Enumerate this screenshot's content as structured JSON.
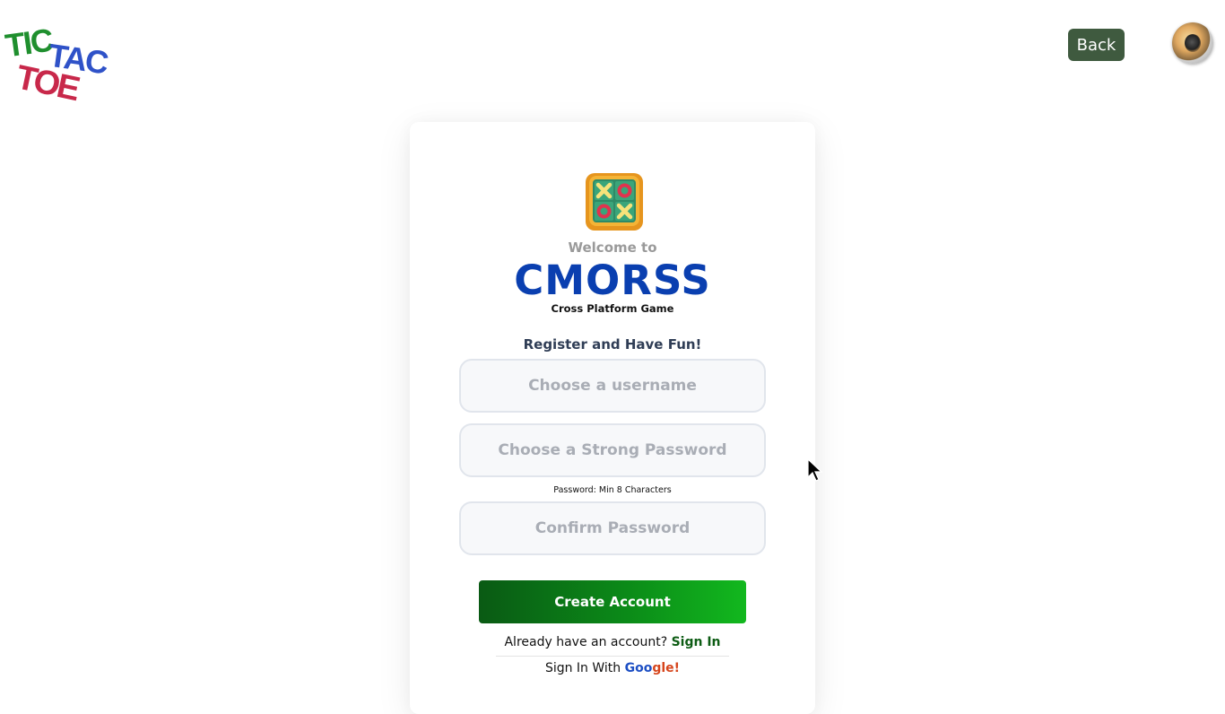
{
  "logo": {
    "line1": "TIC",
    "line2": "TAC",
    "line3": "TOE"
  },
  "header": {
    "back_label": "Back",
    "sound_icon": "speaker-icon"
  },
  "card": {
    "game_icon": "tic-tac-toe-board-icon",
    "welcome": "Welcome to",
    "brand": "CMORSS",
    "tagline": "Cross Platform Game",
    "register_title": "Register and Have Fun!",
    "username_placeholder": "Choose a username",
    "password_placeholder": "Choose a Strong Password",
    "password_hint": "Password: Min 8 Characters",
    "confirm_placeholder": "Confirm Password",
    "create_label": "Create Account",
    "have_account_text": "Already have an account?",
    "signin_label": "Sign In",
    "google_prefix": "Sign In With",
    "google_word_a": "Goo",
    "google_word_b": "gle!"
  },
  "colors": {
    "brand": "#0a3fb0",
    "back_button": "#3f5a3f",
    "create_button_start": "#0a5a14",
    "create_button_end": "#12b81e",
    "signin_link": "#0d5c14"
  }
}
